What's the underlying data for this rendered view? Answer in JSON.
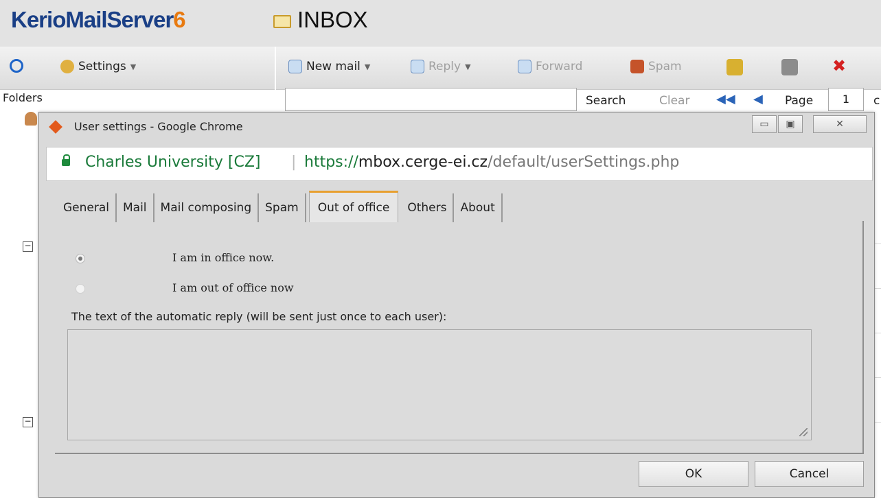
{
  "app": {
    "brand_main": "KerioMailServer",
    "brand_version": "6",
    "folder_title": "INBOX"
  },
  "toolbar_left": {
    "settings": "Settings"
  },
  "toolbar_right": {
    "new_mail": "New mail",
    "reply": "Reply",
    "forward": "Forward",
    "spam": "Spam"
  },
  "sidebar": {
    "folders_label": "Folders"
  },
  "search": {
    "search_button": "Search",
    "clear_button": "Clear",
    "page_label": "Page",
    "page_value": "1",
    "page_suffix": "c"
  },
  "dialog": {
    "window_title": "User settings - Google Chrome",
    "site_name": "Charles University [CZ]",
    "url_scheme": "https://",
    "url_host": "mbox.cerge-ei.cz",
    "url_path": "/default/userSettings.php",
    "tabs": [
      "General",
      "Mail",
      "Mail composing",
      "Spam",
      "Out of office",
      "Others",
      "About"
    ],
    "active_tab": "Out of office",
    "options": {
      "in_office": "I am in office now.",
      "out_of_office": "I am out of office now",
      "selected": "in_office"
    },
    "reply_label": "The text of the automatic reply (will be sent just once to each user):",
    "reply_text": "",
    "ok_button": "OK",
    "cancel_button": "Cancel"
  },
  "colors": {
    "brand": "#1a3f86",
    "accent": "#e87a10",
    "secure": "#1a7a3a",
    "active_tab": "#e8a030"
  }
}
